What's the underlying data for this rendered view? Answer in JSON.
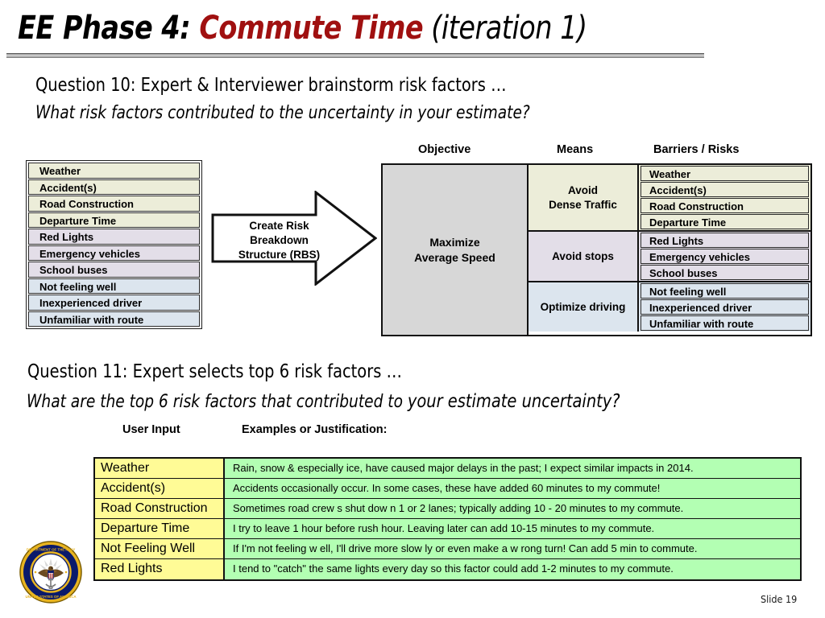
{
  "slide": {
    "title_prefix": "EE Phase 4: ",
    "title_accent": "Commute Time",
    "title_suffix": " (iteration 1)",
    "number_label": "Slide 19",
    "accent_color": "#A01010"
  },
  "question10": {
    "heading": "Question 10: Expert & Interviewer brainstorm risk factors …",
    "subheading": "What risk factors contributed to the uncertainty in your estimate?"
  },
  "question11": {
    "heading": "Question 11: Expert selects top 6 risk factors …",
    "subheading_plain": "What are the top 6 risk factors that contributed to ",
    "subheading_emph": "your estimate uncertainty?"
  },
  "risk_list": {
    "items": [
      {
        "label": "Weather",
        "color": "#ECEDD9"
      },
      {
        "label": "Accident(s)",
        "color": "#ECEDD9"
      },
      {
        "label": "Road Construction",
        "color": "#ECEDD9"
      },
      {
        "label": "Departure Time",
        "color": "#ECEDD9"
      },
      {
        "label": "Red Lights",
        "color": "#E3DEE8"
      },
      {
        "label": "Emergency vehicles",
        "color": "#E3DEE8"
      },
      {
        "label": "School buses",
        "color": "#E3DEE8"
      },
      {
        "label": "Not feeling well",
        "color": "#DCE5EE"
      },
      {
        "label": "Inexperienced driver",
        "color": "#DCE5EE"
      },
      {
        "label": "Unfamiliar with route",
        "color": "#DCE5EE"
      }
    ]
  },
  "arrow": {
    "label_line1": "Create Risk",
    "label_line2": "Breakdown",
    "label_line3": "Structure (RBS)"
  },
  "rbs": {
    "headers": {
      "objective": "Objective",
      "means": "Means",
      "barriers": "Barriers / Risks"
    },
    "objective_line1": "Maximize",
    "objective_line2": "Average Speed",
    "objective_color": "#D7D7D7",
    "groups": [
      {
        "means_line1": "Avoid",
        "means_line2": "Dense Traffic",
        "color": "#ECEDD9",
        "barriers": [
          "Weather",
          "Accident(s)",
          "Road Construction",
          "Departure Time"
        ]
      },
      {
        "means_line1": "Avoid stops",
        "means_line2": "",
        "color": "#E3DEE8",
        "barriers": [
          "Red Lights",
          "Emergency vehicles",
          "School buses"
        ]
      },
      {
        "means_line1": "Optimize driving",
        "means_line2": "",
        "color": "#DCE5EE",
        "barriers": [
          "Not feeling well",
          "Inexperienced driver",
          "Unfamiliar with route"
        ]
      }
    ]
  },
  "justification": {
    "headers": {
      "user_input": "User Input",
      "examples": "Examples or Justification:"
    },
    "factor_color": "#FFFB96",
    "text_color": "#B3FFB3",
    "rows": [
      {
        "factor": "Weather",
        "text": "Rain, snow  & especially ice, have caused major delays in the past; I expect similar impacts in 2014."
      },
      {
        "factor": "Accident(s)",
        "text": "Accidents occasionally occur.  In some cases, these have added 60 minutes to my commute!"
      },
      {
        "factor": "Road Construction",
        "text": "Sometimes road crew s shut dow n 1 or 2 lanes; typically adding 10 - 20 minutes to my commute."
      },
      {
        "factor": "Departure Time",
        "text": "I try to leave 1 hour before rush hour.  Leaving later can add 10-15 minutes to my commute."
      },
      {
        "factor": "Not Feeling Well",
        "text": "If I'm not feeling w ell, I'll drive more slow ly or even make a w rong turn! Can add 5 min to commute."
      },
      {
        "factor": "Red Lights",
        "text": "I tend to \"catch\" the same lights every day so this factor could add 1-2 minutes to my commute."
      }
    ]
  },
  "seal": {
    "name": "navy-seal"
  }
}
